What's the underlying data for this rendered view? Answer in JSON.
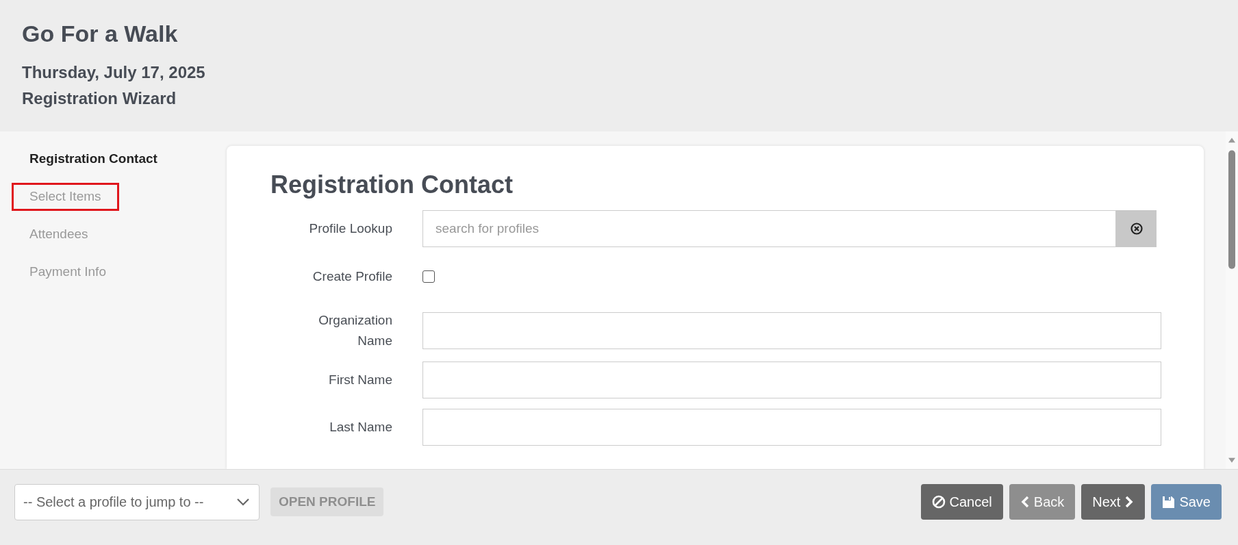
{
  "header": {
    "title": "Go For a Walk",
    "date": "Thursday, July 17, 2025",
    "subtitle": "Registration Wizard"
  },
  "steps": [
    {
      "label": "Registration Contact",
      "selected": true,
      "highlighted": false
    },
    {
      "label": "Select Items",
      "selected": false,
      "highlighted": true
    },
    {
      "label": "Attendees",
      "selected": false,
      "highlighted": false
    },
    {
      "label": "Payment Info",
      "selected": false,
      "highlighted": false
    }
  ],
  "form": {
    "heading": "Registration Contact",
    "fields": [
      {
        "kind": "search",
        "label": "Profile Lookup",
        "placeholder": "search for profiles"
      },
      {
        "kind": "checkbox",
        "label": "Create Profile",
        "checked": false
      },
      {
        "kind": "text",
        "label": "Organization Name"
      },
      {
        "kind": "text",
        "label": "First Name"
      },
      {
        "kind": "text",
        "label": "Last Name"
      }
    ]
  },
  "footer": {
    "profile_select": {
      "placeholder": "-- Select a profile to jump to --"
    },
    "open_profile": {
      "label": "OPEN PROFILE",
      "disabled": true
    },
    "buttons": [
      {
        "kind": "cancel",
        "label": "Cancel",
        "disabled": false
      },
      {
        "kind": "back",
        "label": "Back",
        "disabled": true
      },
      {
        "kind": "next",
        "label": "Next",
        "disabled": false
      },
      {
        "kind": "save",
        "label": "Save",
        "disabled": false
      }
    ]
  }
}
